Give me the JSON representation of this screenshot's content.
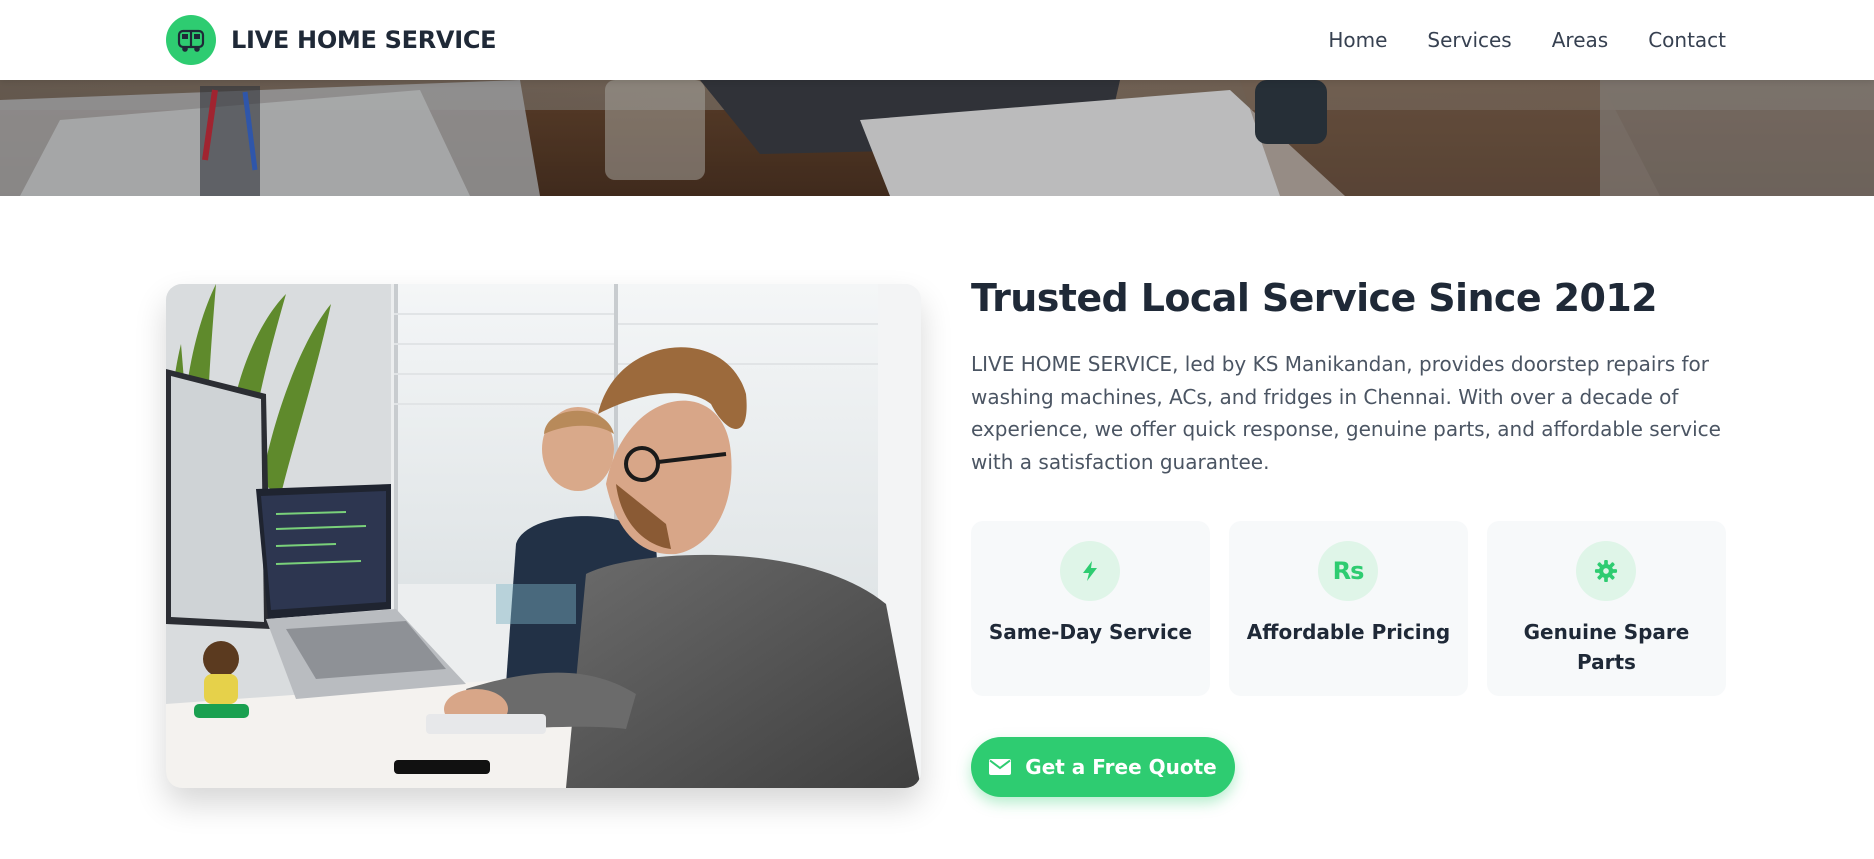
{
  "header": {
    "brand_name": "LIVE HOME SERVICE",
    "logo_icon": "truck-icon",
    "nav": [
      {
        "label": "Home"
      },
      {
        "label": "Services"
      },
      {
        "label": "Areas"
      },
      {
        "label": "Contact"
      }
    ]
  },
  "hero": {
    "image": "office-desk-photo"
  },
  "about": {
    "image": "two-men-working-at-computers-photo",
    "title": "Trusted Local Service Since 2012",
    "description": "LIVE HOME SERVICE, led by KS Manikandan, provides doorstep repairs for washing machines, ACs, and fridges in Chennai. With over a decade of experience, we offer quick response, genuine parts, and affordable service with a satisfaction guarantee.",
    "features": [
      {
        "icon": "bolt-icon",
        "label": "Same-Day Service"
      },
      {
        "icon": "rupee-icon",
        "glyph": "Rs",
        "label": "Affordable Pricing"
      },
      {
        "icon": "gear-icon",
        "label": "Genuine Spare Parts"
      }
    ],
    "cta": {
      "icon": "envelope-icon",
      "label": "Get a Free Quote"
    }
  },
  "colors": {
    "accent": "#2ecc71",
    "accent_light": "#dff5e8",
    "heading": "#1f2937",
    "body_text": "#4b5563",
    "card_bg": "#f7f9fa"
  }
}
